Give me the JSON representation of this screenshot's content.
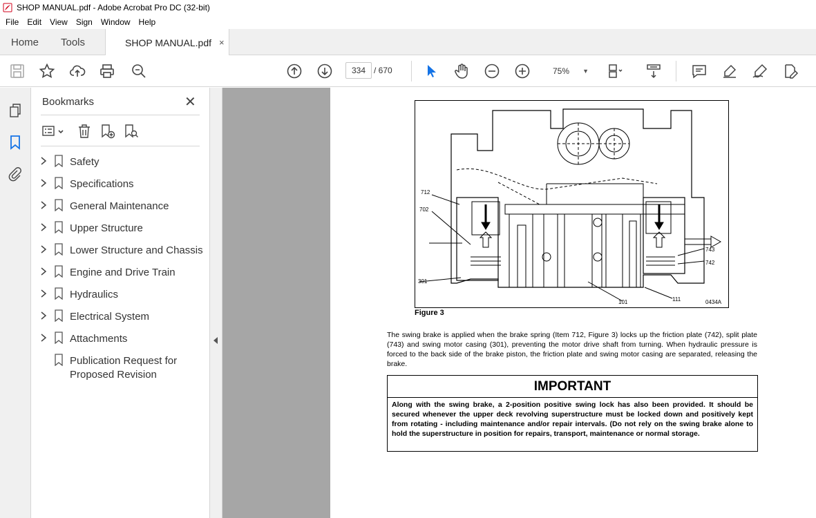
{
  "window": {
    "title": "SHOP MANUAL.pdf - Adobe Acrobat Pro DC (32-bit)"
  },
  "menu": [
    "File",
    "Edit",
    "View",
    "Sign",
    "Window",
    "Help"
  ],
  "tabs": {
    "home": "Home",
    "tools": "Tools",
    "document": "SHOP MANUAL.pdf",
    "close_glyph": "×"
  },
  "toolbar": {
    "current_page": "334",
    "total_pages": "/ 670",
    "zoom": "75%",
    "icons": [
      "save-icon",
      "star-icon",
      "upload-icon",
      "print-icon",
      "zoom-search-icon",
      "page-up-icon",
      "page-down-icon",
      "select-cursor-icon",
      "hand-icon",
      "zoom-out-icon",
      "zoom-in-icon",
      "fit-page-icon",
      "scroll-mode-icon",
      "comment-icon",
      "highlight-icon",
      "sign-icon",
      "edit-pdf-icon"
    ]
  },
  "bookmarks": {
    "title": "Bookmarks",
    "close_glyph": "✕",
    "items": [
      {
        "label": "Safety",
        "expandable": true
      },
      {
        "label": "Specifications",
        "expandable": true
      },
      {
        "label": "General Maintenance",
        "expandable": true
      },
      {
        "label": "Upper Structure",
        "expandable": true
      },
      {
        "label": "Lower Structure and Chassis",
        "expandable": true
      },
      {
        "label": "Engine and Drive Train",
        "expandable": true
      },
      {
        "label": "Hydraulics",
        "expandable": true
      },
      {
        "label": "Electrical System",
        "expandable": true
      },
      {
        "label": "Attachments",
        "expandable": true
      },
      {
        "label": "Publication Request for Proposed Revision",
        "expandable": false
      }
    ]
  },
  "document": {
    "figure_caption": "Figure 3",
    "figure_labels": {
      "l712": "712",
      "l702": "702",
      "l301": "301",
      "l743": "743",
      "l742": "742",
      "l101": "101",
      "l111": "111",
      "code": "0434A"
    },
    "body": "The swing brake is applied when the brake spring (Item 712, Figure 3) locks up the friction plate (742), split plate (743) and swing motor casing (301), preventing the motor drive shaft from turning. When hydraulic pressure is forced to the back side of the brake piston, the friction plate and swing motor casing are separated, releasing the brake.",
    "important_title": "IMPORTANT",
    "important_text": "Along with the swing brake, a 2-position positive swing lock has also been provided. It should be secured whenever the upper deck revolving superstructure must be locked down and positively kept from rotating - including maintenance and/or repair intervals. (Do not rely on the swing brake alone to hold the superstructure in position for repairs, transport, maintenance or normal storage."
  }
}
